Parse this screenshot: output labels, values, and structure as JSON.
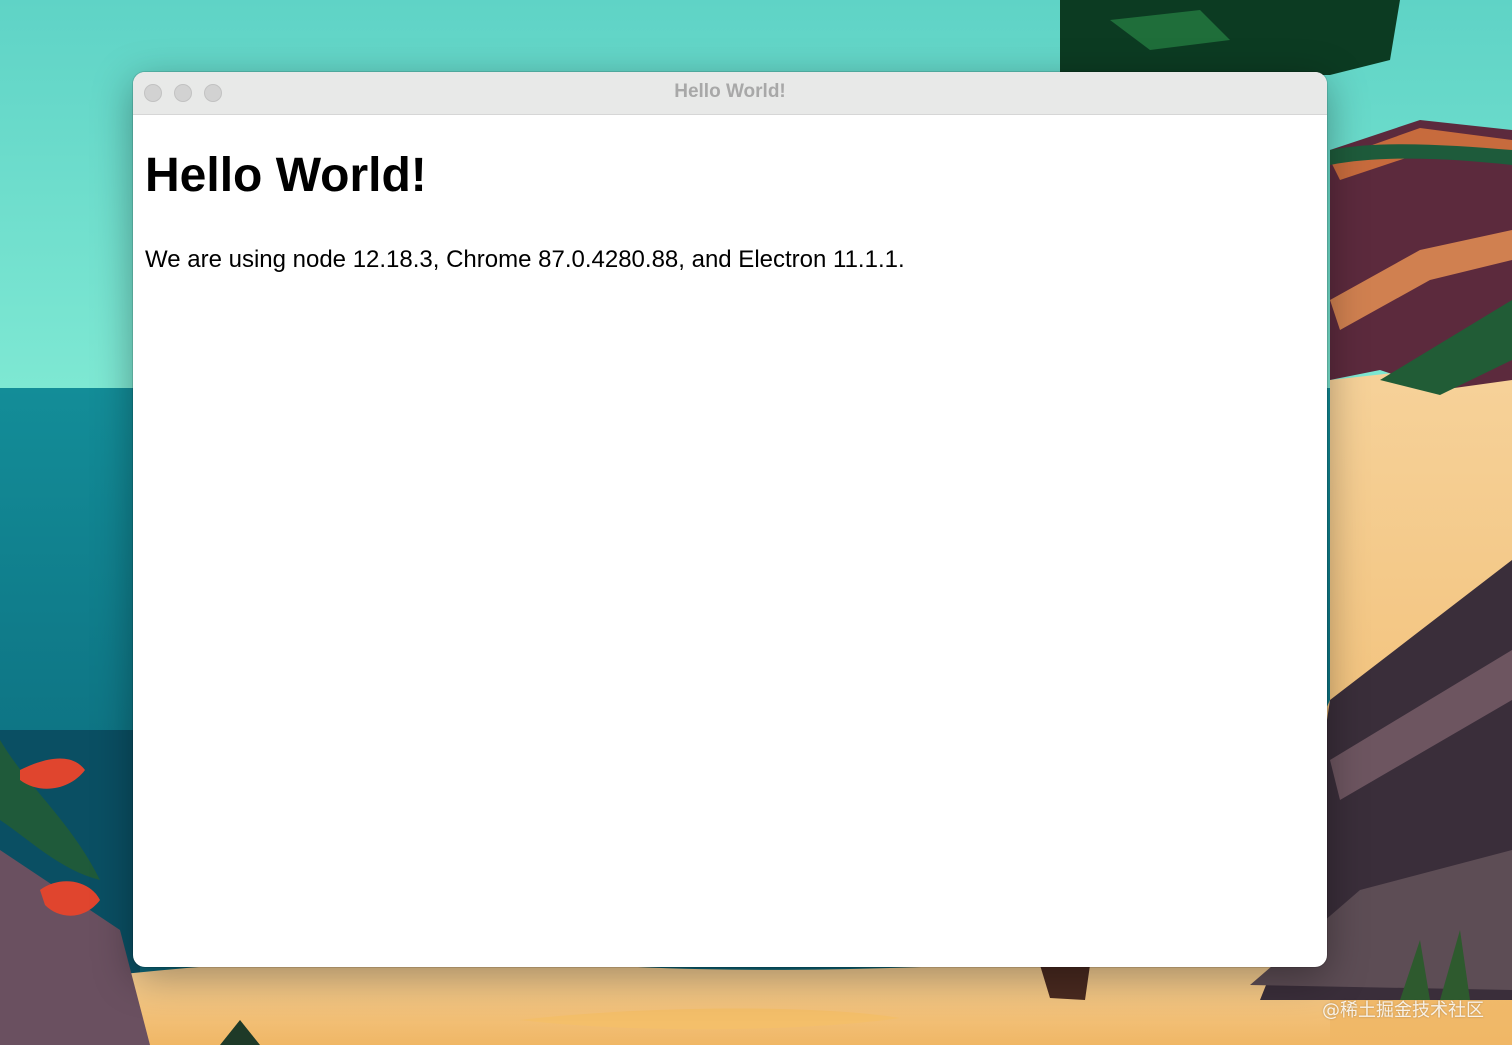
{
  "window": {
    "title": "Hello World!"
  },
  "page": {
    "heading": "Hello World!",
    "text": "We are using node 12.18.3, Chrome 87.0.4280.88, and Electron 11.1.1."
  },
  "watermark": "@稀土掘金技术社区",
  "colors": {
    "sky": "#62d6c8",
    "sea": "#0f7f8a",
    "sand": "#f3c079",
    "window_background": "#ffffff",
    "titlebar": "#e8e9e8",
    "traffic_light_inactive": "#d2d2d2"
  }
}
